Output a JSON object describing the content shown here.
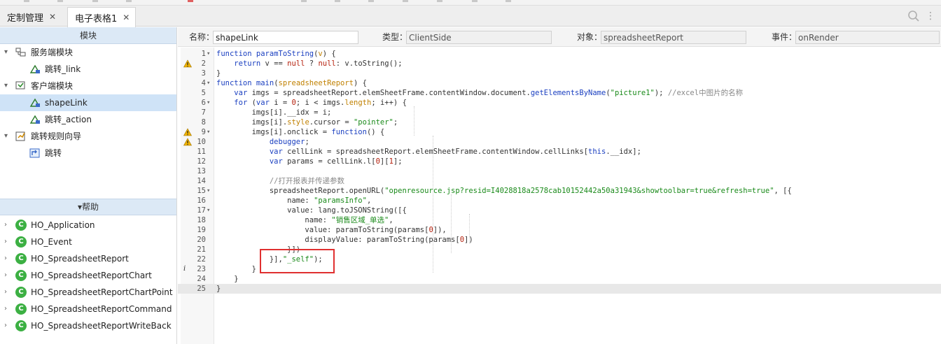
{
  "tabs": [
    {
      "label": "定制管理",
      "active": false
    },
    {
      "label": "电子表格1",
      "active": true
    }
  ],
  "tab_close_glyph": "✕",
  "left_panel": {
    "header": "模块",
    "tree": [
      {
        "label": "服务端模块",
        "level": 0,
        "icon": "server-module-icon",
        "expanded": true
      },
      {
        "label": "跳转_link",
        "level": 1,
        "icon": "script-icon"
      },
      {
        "label": "客户端模块",
        "level": 0,
        "icon": "client-module-icon",
        "expanded": true
      },
      {
        "label": "shapeLink",
        "level": 1,
        "icon": "script-icon",
        "selected": true
      },
      {
        "label": "跳转_action",
        "level": 1,
        "icon": "script-icon"
      },
      {
        "label": "跳转规则向导",
        "level": 0,
        "icon": "wizard-icon",
        "expanded": true
      },
      {
        "label": "跳转",
        "level": 1,
        "icon": "jump-icon"
      }
    ],
    "help_header": "▾帮助",
    "help_items": [
      {
        "label": "HO_Application",
        "icon_letter": "C"
      },
      {
        "label": "HO_Event",
        "icon_letter": "C"
      },
      {
        "label": "HO_SpreadsheetReport",
        "icon_letter": "C"
      },
      {
        "label": "HO_SpreadsheetReportChart",
        "icon_letter": "C"
      },
      {
        "label": "HO_SpreadsheetReportChartPoint",
        "icon_letter": "C"
      },
      {
        "label": "HO_SpreadsheetReportCommand",
        "icon_letter": "C"
      },
      {
        "label": "HO_SpreadsheetReportWriteBack",
        "icon_letter": "C"
      }
    ]
  },
  "props": {
    "name_label": "名称：",
    "name_value": "shapeLink",
    "type_label": "类型：",
    "type_value": "ClientSide",
    "object_label": "对象：",
    "object_value": "spreadsheetReport",
    "event_label": "事件：",
    "event_value": "onRender"
  },
  "colors": {
    "accent_panel": "#dce9f6",
    "selected_row": "#cfe3f7",
    "highlight_box": "#e03030",
    "class_icon": "#3cb043"
  },
  "editor": {
    "current_line": 25,
    "lines": [
      {
        "n": "1",
        "fold": "▾",
        "mark": "",
        "html": "<span class=\"k\">function</span> <span class=\"k\">paramToString</span>(<span class=\"o\">v</span>) {"
      },
      {
        "n": "2",
        "fold": "",
        "mark": "warn",
        "html": "    <span class=\"k\">return</span> v == <span class=\"n\">null</span> ? <span class=\"n\">null</span>: v.toString();"
      },
      {
        "n": "3",
        "fold": "",
        "mark": "",
        "html": "}"
      },
      {
        "n": "4",
        "fold": "▾",
        "mark": "",
        "html": "<span class=\"k\">function</span> <span class=\"k\">main</span>(<span class=\"o\">spreadsheetReport</span>) {"
      },
      {
        "n": "5",
        "fold": "",
        "mark": "",
        "html": "    <span class=\"k\">var</span> imgs = spreadsheetReport.elemSheetFrame.contentWindow.document.<span class=\"k\">getElementsByName</span>(<span class=\"s\">\"picture1\"</span>); <span class=\"c\">//excel中图片的名称</span>"
      },
      {
        "n": "6",
        "fold": "▾",
        "mark": "",
        "html": "    <span class=\"k\">for</span> (<span class=\"k\">var</span> i = <span class=\"n\">0</span>; i &lt; imgs.<span class=\"o\">length</span>; i++) {"
      },
      {
        "n": "7",
        "fold": "",
        "mark": "",
        "html": "        imgs[i].__idx = i;"
      },
      {
        "n": "8",
        "fold": "",
        "mark": "",
        "html": "        imgs[i].<span class=\"o\">style</span>.cursor = <span class=\"s\">\"pointer\"</span>;"
      },
      {
        "n": "9",
        "fold": "▾",
        "mark": "warn",
        "html": "        imgs[i].onclick = <span class=\"k\">function</span>() {"
      },
      {
        "n": "10",
        "fold": "",
        "mark": "warn",
        "html": "            <span class=\"k\">debugger</span>;"
      },
      {
        "n": "11",
        "fold": "",
        "mark": "",
        "html": "            <span class=\"k\">var</span> cellLink = spreadsheetReport.elemSheetFrame.contentWindow.cellLinks[<span class=\"k\">this</span>.__idx];"
      },
      {
        "n": "12",
        "fold": "",
        "mark": "",
        "html": "            <span class=\"k\">var</span> params = cellLink.l[<span class=\"n\">0</span>][<span class=\"n\">1</span>];"
      },
      {
        "n": "13",
        "fold": "",
        "mark": "",
        "html": ""
      },
      {
        "n": "14",
        "fold": "",
        "mark": "",
        "html": "            <span class=\"c\">//打开报表并传递参数</span>"
      },
      {
        "n": "15",
        "fold": "▾",
        "mark": "",
        "html": "            spreadsheetReport.openURL(<span class=\"s\">\"openresource.jsp?resid=I4028818a2578cab10152442a50a31943&amp;showtoolbar=true&amp;refresh=true\"</span>, [{"
      },
      {
        "n": "16",
        "fold": "",
        "mark": "",
        "html": "                name: <span class=\"s\">\"paramsInfo\"</span>,"
      },
      {
        "n": "17",
        "fold": "▾",
        "mark": "",
        "html": "                value: lang.toJSONString([{"
      },
      {
        "n": "18",
        "fold": "",
        "mark": "",
        "html": "                    name: <span class=\"s\">\"销售区域_单选\"</span>,"
      },
      {
        "n": "19",
        "fold": "",
        "mark": "",
        "html": "                    value: paramToString(params[<span class=\"n\">0</span>]),"
      },
      {
        "n": "20",
        "fold": "",
        "mark": "",
        "html": "                    displayValue: paramToString(params[<span class=\"n\">0</span>])"
      },
      {
        "n": "21",
        "fold": "",
        "mark": "",
        "html": "                }])"
      },
      {
        "n": "22",
        "fold": "",
        "mark": "",
        "html": "            }],<span class=\"s\">\"_self\"</span>);"
      },
      {
        "n": "23",
        "fold": "",
        "mark": "info",
        "html": "        }"
      },
      {
        "n": "24",
        "fold": "",
        "mark": "",
        "html": "    }"
      },
      {
        "n": "25",
        "fold": "",
        "mark": "",
        "html": "}"
      }
    ]
  }
}
